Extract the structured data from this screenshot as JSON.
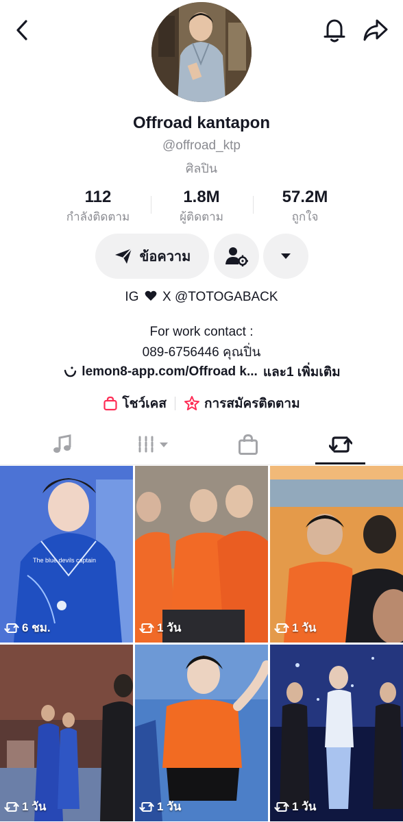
{
  "profile": {
    "display_name": "Offroad kantapon",
    "username": "@offroad_ktp",
    "category": "ศิลปิน"
  },
  "stats": [
    {
      "value": "112",
      "label": "กำลังติดตาม"
    },
    {
      "value": "1.8M",
      "label": "ผู้ติดตาม"
    },
    {
      "value": "57.2M",
      "label": "ถูกใจ"
    }
  ],
  "actions": {
    "message_label": "ข้อความ"
  },
  "bio": {
    "ig_left": "IG",
    "ig_right": "X @TOTOGABACK",
    "work_line": "For work contact :",
    "phone_line": "089-6756446 คุณปิ่น",
    "link_text": "lemon8-app.com/Offroad k...",
    "link_more": "และ1 เพิ่มเติม"
  },
  "shop": {
    "showcase_label": "โชว์เคส",
    "subscribe_label": "การสมัครติดตาม"
  },
  "grid": {
    "items": [
      {
        "time": "6 ชม.",
        "caption": "The blue devils captain"
      },
      {
        "time": "1 วัน"
      },
      {
        "time": "1 วัน"
      },
      {
        "time": "1 วัน"
      },
      {
        "time": "1 วัน"
      },
      {
        "time": "1 วัน"
      }
    ]
  },
  "colors": {
    "accent_pink": "#fe2c55",
    "text": "#161823",
    "secondary": "#8a8b91"
  }
}
